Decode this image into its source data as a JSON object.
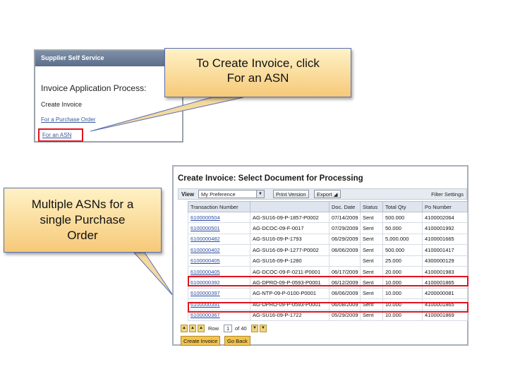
{
  "callouts": {
    "create_invoice_line1": "To Create Invoice, click",
    "create_invoice_line2": "For an ASN",
    "multiple_line1": "Multiple ASNs for a",
    "multiple_line2": "single Purchase",
    "multiple_line3": "Order"
  },
  "supplier_panel": {
    "header": "Supplier Self Service",
    "title": "Invoice Application Process:",
    "create_invoice": "Create Invoice",
    "for_po_link": "For a Purchase Order",
    "for_asn_link": "For an ASN"
  },
  "create_invoice": {
    "title": "Create Invoice: Select Document for Processing",
    "view_label": "View",
    "view_value": "My Preference",
    "print_version": "Print Version",
    "export": "Export",
    "filter_settings": "Filter Settings",
    "columns": [
      "Transaction Number",
      "",
      "Doc. Date",
      "Status",
      "Total Qty",
      "Po Number"
    ],
    "rows": [
      [
        "6100000504",
        "AG-SU16-09-P-1857-P0002",
        "07/14/2009",
        "Sent",
        "500.000",
        "4100002064"
      ],
      [
        "6100000501",
        "AG-DCOC-09-F-0017",
        "07/29/2009",
        "Sent",
        "50.000",
        "4100001992"
      ],
      [
        "6100000482",
        "AG-SU16-09-P-1793",
        "06/29/2009",
        "Sent",
        "5,000.000",
        "4100001665"
      ],
      [
        "6100000402",
        "AG-SU16-09-P-1277-P0002",
        "06/06/2009",
        "Sent",
        "500.000",
        "4100001417"
      ],
      [
        "6100000405",
        "AG-SU16-09-P-1280",
        "",
        "Sent",
        "25.000",
        "4300000129"
      ],
      [
        "6100000405",
        "AG-DCOC-09-F-0211-P0001",
        "06/17/2009",
        "Sent",
        "20.000",
        "4100001983"
      ],
      [
        "6100000392",
        "AG-DPRO-09-P-0593-P0001",
        "06/12/2009",
        "Sent",
        "10.000",
        "4100001865"
      ],
      [
        "6100000397",
        "AG-NTP-09-P-0100-P0001",
        "06/06/2009",
        "Sent",
        "10.000",
        "4200000081"
      ],
      [
        "6100000391",
        "AG-DPRO-09-P-0593-P0001",
        "06/08/2009",
        "Sent",
        "10.000",
        "4100001865"
      ],
      [
        "6100000367",
        "AG-SU16-09-P-1722",
        "05/29/2009",
        "Sent",
        "10.000",
        "4100001869"
      ]
    ],
    "pager": {
      "row_label": "Row",
      "row_value": "1",
      "of_label": "of 40"
    },
    "create_button": "Create Invoice",
    "go_back_button": "Go Back"
  },
  "colors": {
    "highlight": "#e0141e",
    "link": "#2c4fa0",
    "callout_top": "#fff2c6",
    "callout_bottom": "#f6c978"
  }
}
